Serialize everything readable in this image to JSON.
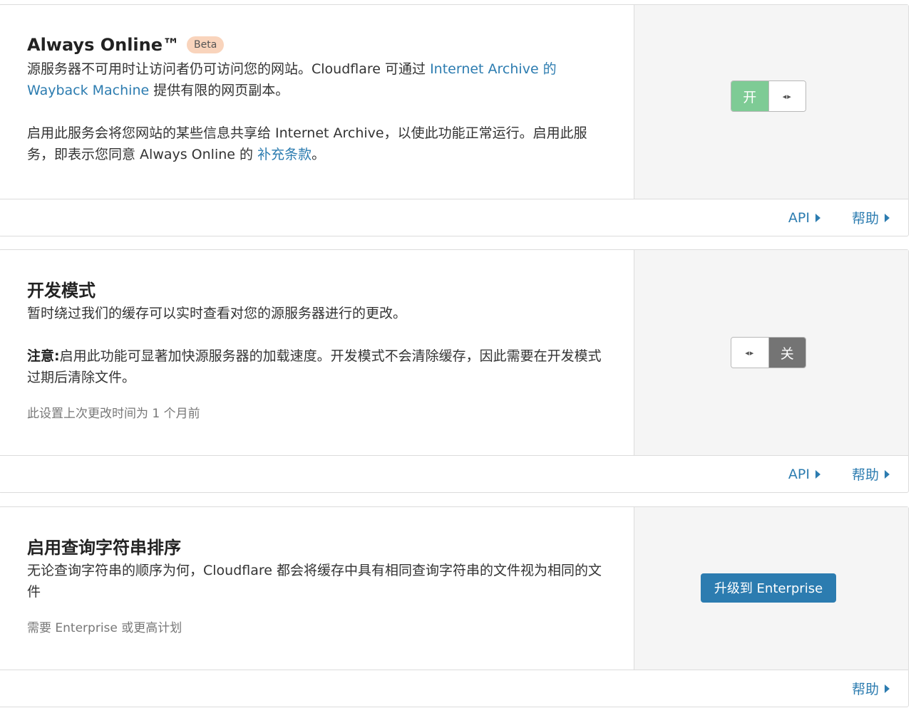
{
  "cards": [
    {
      "title": "Always Online™",
      "badge": "Beta",
      "desc_p1_text": "源服务器不可用时让访问者仍可访问您的网站。Cloudflare 可通过 ",
      "desc_p1_link": "Internet Archive 的 Wayback Machine",
      "desc_p1_after": " 提供有限的网页副本。",
      "desc_p2_text": "启用此服务会将您网站的某些信息共享给 Internet Archive，以使此功能正常运行。启用此服务，即表示您同意 Always Online 的 ",
      "desc_p2_link": "补充条款",
      "desc_p2_after": "。",
      "toggle_on_label": "开",
      "toggle_knob": "◂▸",
      "footer_api": "API",
      "footer_help": "帮助"
    },
    {
      "title": "开发模式",
      "desc_p1": "暂时绕过我们的缓存可以实时查看对您的源服务器进行的更改。",
      "note_label": "注意:",
      "note_text": "启用此功能可显著加快源服务器的加载速度。开发模式不会清除缓存，因此需要在开发模式过期后清除文件。",
      "last_changed": "此设置上次更改时间为 1 个月前",
      "toggle_off_label": "关",
      "toggle_knob": "◂▸",
      "footer_api": "API",
      "footer_help": "帮助"
    },
    {
      "title": "启用查询字符串排序",
      "desc_p1": "无论查询字符串的顺序为何，Cloudflare 都会将缓存中具有相同查询字符串的文件视为相同的文件",
      "requirement": "需要 Enterprise 或更高计划",
      "upgrade_button": "升级到 Enterprise",
      "footer_help": "帮助"
    }
  ]
}
